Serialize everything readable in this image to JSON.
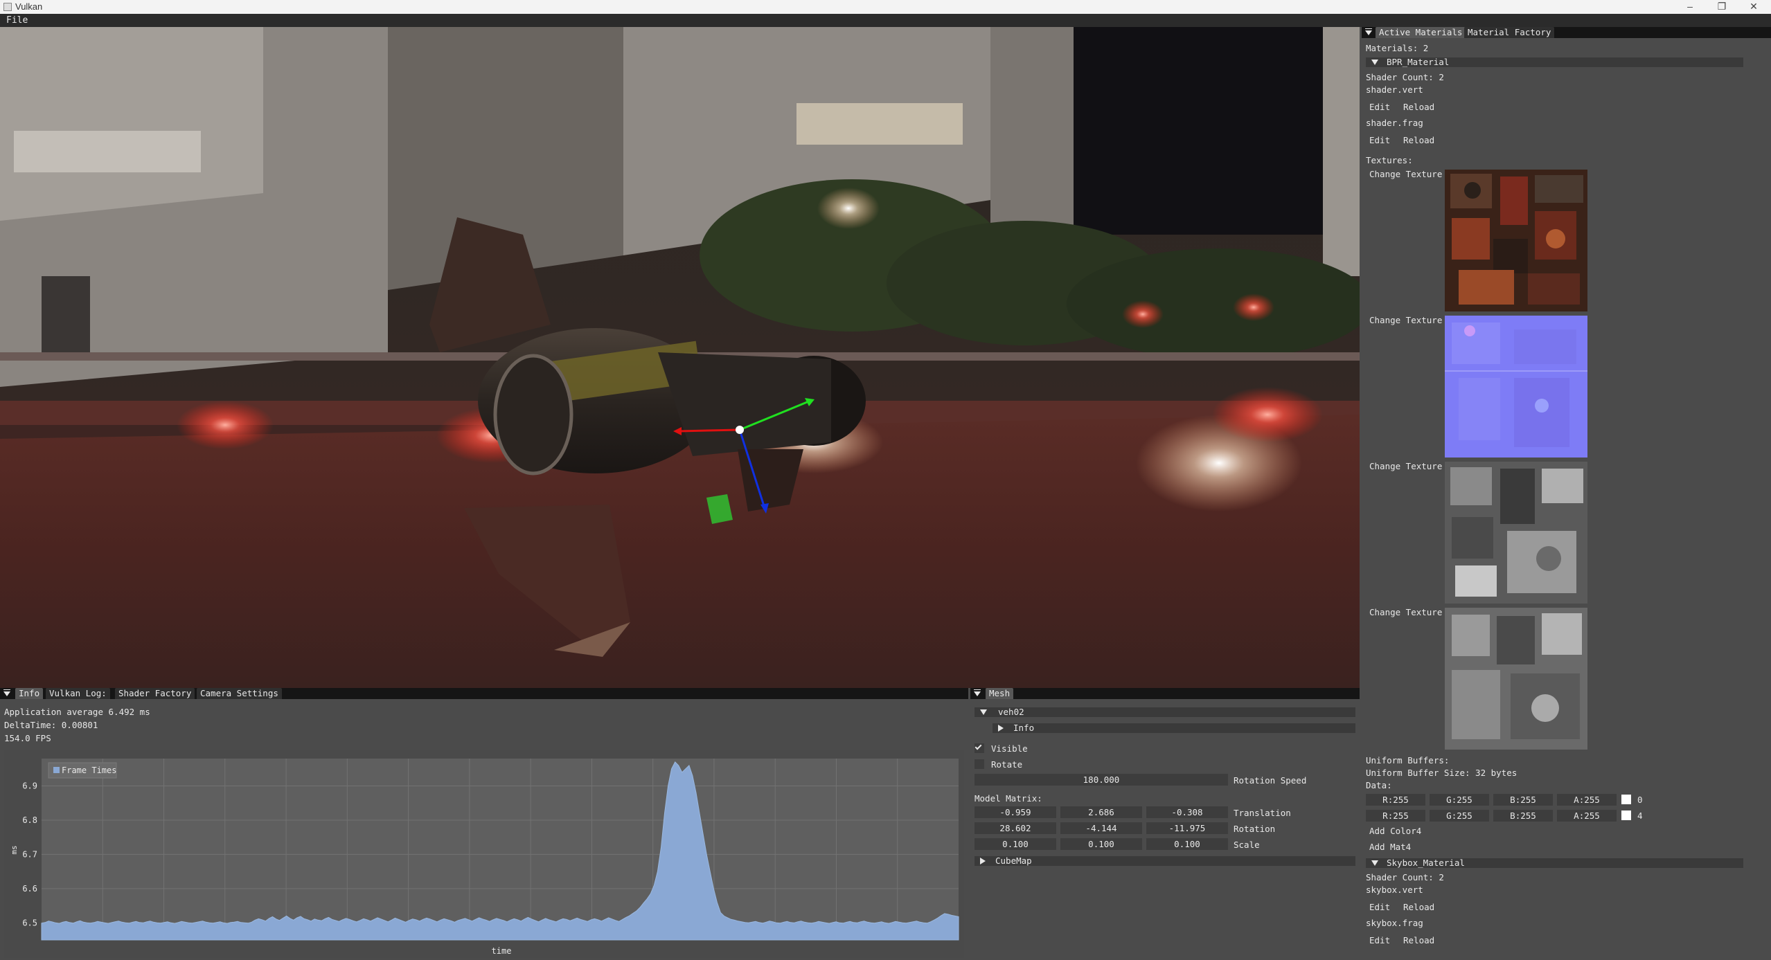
{
  "window": {
    "title": "Vulkan",
    "minimize_icon": "minimize-icon",
    "maximize_icon": "restore-icon",
    "close_icon": "close-icon"
  },
  "menubar": {
    "file": "File"
  },
  "bottom_left_tabs": [
    "Info",
    "Vulkan Log:",
    "Shader Factory",
    "Camera Settings"
  ],
  "info": {
    "app_average": "Application average 6.492 ms",
    "delta_time": "DeltaTime: 0.00801",
    "fps": "154.0 FPS"
  },
  "mesh_tabs": [
    "Mesh"
  ],
  "mesh": {
    "name": "veh02",
    "info_label": "Info",
    "visible_label": "Visible",
    "visible_checked": true,
    "rotate_label": "Rotate",
    "rotate_checked": false,
    "rotation_speed_value": "180.000",
    "rotation_speed_label": "Rotation Speed",
    "model_matrix_label": "Model Matrix:",
    "translation": [
      "-0.959",
      "2.686",
      "-0.308"
    ],
    "translation_label": "Translation",
    "rotation": [
      "28.602",
      "-4.144",
      "-11.975"
    ],
    "rotation_label": "Rotation",
    "scale": [
      "0.100",
      "0.100",
      "0.100"
    ],
    "scale_label": "Scale",
    "cubemap_label": "CubeMap"
  },
  "right_tabs": [
    "Active Materials",
    "Material Factory"
  ],
  "materials": {
    "count_label": "Materials: 2",
    "pbr": {
      "name": "BPR_Material",
      "shader_count": "Shader Count: 2",
      "vert": "shader.vert",
      "frag": "shader.frag",
      "edit": "Edit",
      "reload": "Reload",
      "textures_label": "Textures:",
      "change_texture": "Change Texture"
    },
    "uniform_buffers_label": "Uniform Buffers:",
    "uniform_buffer_size": "Uniform Buffer Size: 32 bytes",
    "data_label": "Data:",
    "rows": [
      {
        "r": "R:255",
        "g": "G:255",
        "b": "B:255",
        "a": "A:255",
        "index": "0"
      },
      {
        "r": "R:255",
        "g": "G:255",
        "b": "B:255",
        "a": "A:255",
        "index": "4"
      }
    ],
    "add_color4": "Add Color4",
    "add_mat4": "Add Mat4",
    "skybox": {
      "name": "Skybox_Material",
      "shader_count": "Shader Count: 2",
      "vert": "skybox.vert",
      "frag": "skybox.frag"
    }
  },
  "colors": {
    "panel_bg": "#4b4b4b",
    "tab_bar": "#151515",
    "plot_bg": "#5f5f5f",
    "series": "#8aa8d4",
    "field_bg": "#3d3d3d"
  },
  "chart_data": {
    "type": "area",
    "title": "",
    "legend": [
      "Frame Times"
    ],
    "legend_position": "top-left",
    "xlabel": "time",
    "ylabel": "ms",
    "ylim": [
      6.45,
      6.98
    ],
    "yticks": [
      "6.5",
      "6.6",
      "6.7",
      "6.8",
      "6.9"
    ],
    "grid": true,
    "series": [
      {
        "name": "Frame Times",
        "values": [
          6.499,
          6.501,
          6.505,
          6.503,
          6.5,
          6.498,
          6.502,
          6.504,
          6.501,
          6.499,
          6.503,
          6.506,
          6.502,
          6.5,
          6.499,
          6.501,
          6.504,
          6.502,
          6.5,
          6.498,
          6.501,
          6.503,
          6.505,
          6.502,
          6.5,
          6.499,
          6.502,
          6.504,
          6.501,
          6.5,
          6.503,
          6.505,
          6.502,
          6.5,
          6.499,
          6.501,
          6.503,
          6.5,
          6.498,
          6.501,
          6.504,
          6.502,
          6.5,
          6.499,
          6.501,
          6.503,
          6.505,
          6.502,
          6.5,
          6.499,
          6.501,
          6.503,
          6.5,
          6.498,
          6.501,
          6.502,
          6.504,
          6.501,
          6.5,
          6.499,
          6.502,
          6.508,
          6.512,
          6.509,
          6.505,
          6.513,
          6.518,
          6.511,
          6.507,
          6.514,
          6.52,
          6.513,
          6.508,
          6.515,
          6.519,
          6.512,
          6.509,
          6.505,
          6.511,
          6.508,
          6.506,
          6.512,
          6.516,
          6.51,
          6.507,
          6.504,
          6.509,
          6.513,
          6.51,
          6.506,
          6.503,
          6.507,
          6.512,
          6.509,
          6.505,
          6.51,
          6.515,
          6.511,
          6.507,
          6.503,
          6.508,
          6.514,
          6.51,
          6.506,
          6.502,
          6.507,
          6.511,
          6.509,
          6.505,
          6.51,
          6.514,
          6.511,
          6.507,
          6.503,
          6.508,
          6.512,
          6.509,
          6.506,
          6.502,
          6.507,
          6.51,
          6.513,
          6.509,
          6.505,
          6.51,
          6.515,
          6.511,
          6.508,
          6.504,
          6.509,
          6.513,
          6.51,
          6.507,
          6.503,
          6.508,
          6.512,
          6.509,
          6.505,
          6.511,
          6.516,
          6.511,
          6.507,
          6.503,
          6.508,
          6.513,
          6.509,
          6.506,
          6.503,
          6.508,
          6.512,
          6.51,
          6.506,
          6.51,
          6.514,
          6.51,
          6.507,
          6.504,
          6.509,
          6.512,
          6.509,
          6.505,
          6.51,
          6.515,
          6.511,
          6.507,
          6.504,
          6.51,
          6.516,
          6.521,
          6.528,
          6.535,
          6.545,
          6.558,
          6.57,
          6.585,
          6.61,
          6.65,
          6.72,
          6.82,
          6.9,
          6.95,
          6.97,
          6.96,
          6.94,
          6.95,
          6.96,
          6.93,
          6.88,
          6.82,
          6.76,
          6.7,
          6.65,
          6.6,
          6.56,
          6.53,
          6.52,
          6.515,
          6.51,
          6.508,
          6.505,
          6.503,
          6.501,
          6.5,
          6.502,
          6.504,
          6.501,
          6.499,
          6.502,
          6.505,
          6.503,
          6.5,
          6.499,
          6.502,
          6.504,
          6.501,
          6.5,
          6.503,
          6.505,
          6.502,
          6.5,
          6.499,
          6.501,
          6.504,
          6.502,
          6.5,
          6.498,
          6.501,
          6.503,
          6.5,
          6.499,
          6.502,
          6.504,
          6.501,
          6.5,
          6.503,
          6.505,
          6.502,
          6.5,
          6.499,
          6.501,
          6.503,
          6.5,
          6.498,
          6.501,
          6.504,
          6.502,
          6.5,
          6.499,
          6.501,
          6.503,
          6.505,
          6.502,
          6.5,
          6.499,
          6.503,
          6.508,
          6.514,
          6.521,
          6.527,
          6.525,
          6.522,
          6.52,
          6.518
        ]
      }
    ]
  }
}
